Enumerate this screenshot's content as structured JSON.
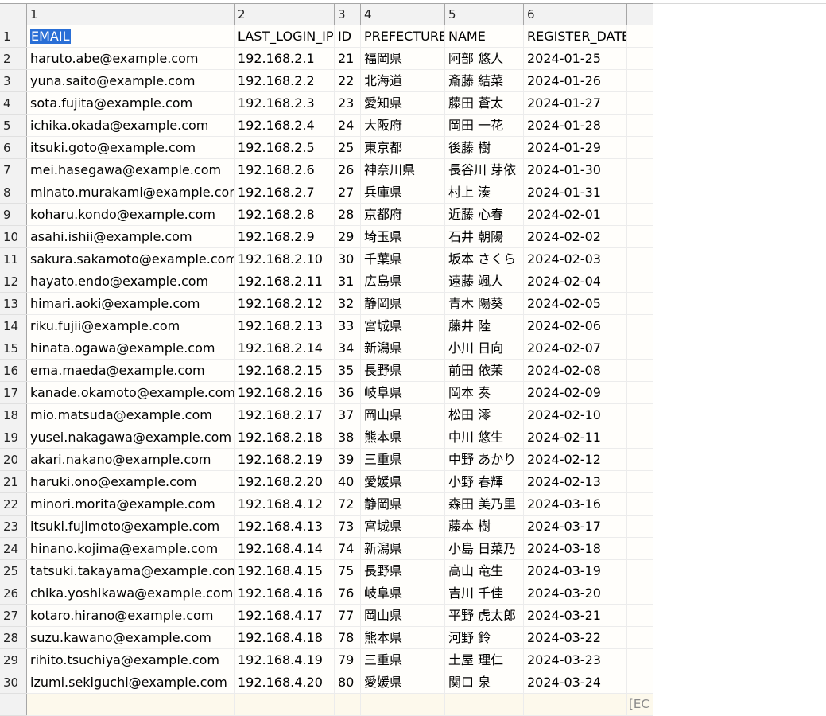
{
  "column_headers": [
    "1",
    "2",
    "3",
    "4",
    "5",
    "6",
    ""
  ],
  "rows": [
    [
      "EMAIL",
      "LAST_LOGIN_IP",
      "ID",
      "PREFECTURE",
      "NAME",
      "REGISTER_DATE"
    ],
    [
      "haruto.abe@example.com",
      "192.168.2.1",
      "21",
      "福岡県",
      "阿部 悠人",
      "2024-01-25"
    ],
    [
      "yuna.saito@example.com",
      "192.168.2.2",
      "22",
      "北海道",
      "斎藤 結菜",
      "2024-01-26"
    ],
    [
      "sota.fujita@example.com",
      "192.168.2.3",
      "23",
      "愛知県",
      "藤田 蒼太",
      "2024-01-27"
    ],
    [
      "ichika.okada@example.com",
      "192.168.2.4",
      "24",
      "大阪府",
      "岡田 一花",
      "2024-01-28"
    ],
    [
      "itsuki.goto@example.com",
      "192.168.2.5",
      "25",
      "東京都",
      "後藤 樹",
      "2024-01-29"
    ],
    [
      "mei.hasegawa@example.com",
      "192.168.2.6",
      "26",
      "神奈川県",
      "長谷川 芽依",
      "2024-01-30"
    ],
    [
      "minato.murakami@example.com",
      "192.168.2.7",
      "27",
      "兵庫県",
      "村上 湊",
      "2024-01-31"
    ],
    [
      "koharu.kondo@example.com",
      "192.168.2.8",
      "28",
      "京都府",
      "近藤 心春",
      "2024-02-01"
    ],
    [
      "asahi.ishii@example.com",
      "192.168.2.9",
      "29",
      "埼玉県",
      "石井 朝陽",
      "2024-02-02"
    ],
    [
      "sakura.sakamoto@example.com",
      "192.168.2.10",
      "30",
      "千葉県",
      "坂本 さくら",
      "2024-02-03"
    ],
    [
      "hayato.endo@example.com",
      "192.168.2.11",
      "31",
      "広島県",
      "遠藤 颯人",
      "2024-02-04"
    ],
    [
      "himari.aoki@example.com",
      "192.168.2.12",
      "32",
      "静岡県",
      "青木 陽葵",
      "2024-02-05"
    ],
    [
      "riku.fujii@example.com",
      "192.168.2.13",
      "33",
      "宮城県",
      "藤井 陸",
      "2024-02-06"
    ],
    [
      "hinata.ogawa@example.com",
      "192.168.2.14",
      "34",
      "新潟県",
      "小川 日向",
      "2024-02-07"
    ],
    [
      "ema.maeda@example.com",
      "192.168.2.15",
      "35",
      "長野県",
      "前田 依茉",
      "2024-02-08"
    ],
    [
      "kanade.okamoto@example.com",
      "192.168.2.16",
      "36",
      "岐阜県",
      "岡本 奏",
      "2024-02-09"
    ],
    [
      "mio.matsuda@example.com",
      "192.168.2.17",
      "37",
      "岡山県",
      "松田 澪",
      "2024-02-10"
    ],
    [
      "yusei.nakagawa@example.com",
      "192.168.2.18",
      "38",
      "熊本県",
      "中川 悠生",
      "2024-02-11"
    ],
    [
      "akari.nakano@example.com",
      "192.168.2.19",
      "39",
      "三重県",
      "中野 あかり",
      "2024-02-12"
    ],
    [
      "haruki.ono@example.com",
      "192.168.2.20",
      "40",
      "愛媛県",
      "小野 春輝",
      "2024-02-13"
    ],
    [
      "minori.morita@example.com",
      "192.168.4.12",
      "72",
      "静岡県",
      "森田 美乃里",
      "2024-03-16"
    ],
    [
      "itsuki.fujimoto@example.com",
      "192.168.4.13",
      "73",
      "宮城県",
      "藤本 樹",
      "2024-03-17"
    ],
    [
      "hinano.kojima@example.com",
      "192.168.4.14",
      "74",
      "新潟県",
      "小島 日菜乃",
      "2024-03-18"
    ],
    [
      "tatsuki.takayama@example.com",
      "192.168.4.15",
      "75",
      "長野県",
      "高山 竜生",
      "2024-03-19"
    ],
    [
      "chika.yoshikawa@example.com",
      "192.168.4.16",
      "76",
      "岐阜県",
      "吉川 千佳",
      "2024-03-20"
    ],
    [
      "kotaro.hirano@example.com",
      "192.168.4.17",
      "77",
      "岡山県",
      "平野 虎太郎",
      "2024-03-21"
    ],
    [
      "suzu.kawano@example.com",
      "192.168.4.18",
      "78",
      "熊本県",
      "河野 鈴",
      "2024-03-22"
    ],
    [
      "rihito.tsuchiya@example.com",
      "192.168.4.19",
      "79",
      "三重県",
      "土屋 理仁",
      "2024-03-23"
    ],
    [
      "izumi.sekiguchi@example.com",
      "192.168.4.20",
      "80",
      "愛媛県",
      "関口 泉",
      "2024-03-24"
    ]
  ],
  "selected_cell": {
    "row": 1,
    "col": 1
  },
  "status_text": "[EC",
  "colors": {
    "selection": "#2a6fd6",
    "header_bg": "#f2f2f2",
    "cell_bg": "#fffefb"
  }
}
